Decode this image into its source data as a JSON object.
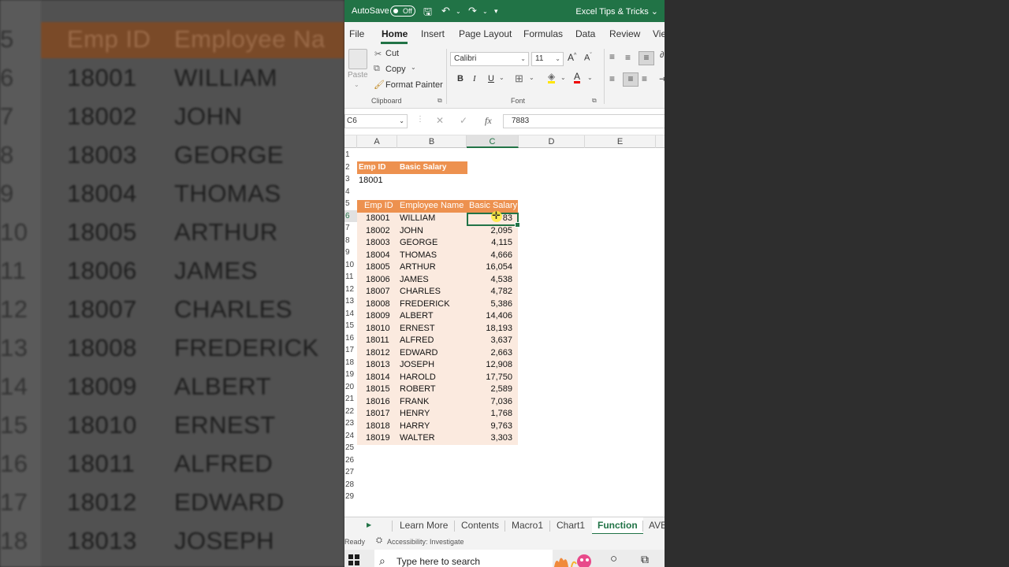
{
  "background": {
    "header": {
      "emp_id": "Emp ID",
      "employee_name": "Employee Na"
    },
    "rows": [
      {
        "num": "5",
        "id": "",
        "name": ""
      },
      {
        "num": "6",
        "id": "18001",
        "name": "WILLIAM"
      },
      {
        "num": "7",
        "id": "18002",
        "name": "JOHN"
      },
      {
        "num": "8",
        "id": "18003",
        "name": "GEORGE"
      },
      {
        "num": "9",
        "id": "18004",
        "name": "THOMAS"
      },
      {
        "num": "10",
        "id": "18005",
        "name": "ARTHUR"
      },
      {
        "num": "11",
        "id": "18006",
        "name": "JAMES"
      },
      {
        "num": "12",
        "id": "18007",
        "name": "CHARLES"
      },
      {
        "num": "13",
        "id": "18008",
        "name": "FREDERICK"
      },
      {
        "num": "14",
        "id": "18009",
        "name": "ALBERT"
      },
      {
        "num": "15",
        "id": "18010",
        "name": "ERNEST"
      },
      {
        "num": "16",
        "id": "18011",
        "name": "ALFRED"
      },
      {
        "num": "17",
        "id": "18012",
        "name": "EDWARD"
      },
      {
        "num": "18",
        "id": "18013",
        "name": "JOSEPH"
      }
    ]
  },
  "titlebar": {
    "autosave_label": "AutoSave",
    "autosave_state": "Off",
    "document_title": "Excel Tips & Tricks",
    "title_chevron": "⌄"
  },
  "tabs": [
    "File",
    "Home",
    "Insert",
    "Page Layout",
    "Formulas",
    "Data",
    "Review",
    "Vie"
  ],
  "ribbon": {
    "paste": "Paste",
    "cut": "Cut",
    "copy": "Copy",
    "format_painter": "Format Painter",
    "clipboard_group": "Clipboard",
    "font_name": "Calibri",
    "font_size": "11",
    "font_group": "Font",
    "bold": "B",
    "italic": "I",
    "underline": "U"
  },
  "formula_bar": {
    "name_box": "C6",
    "fx": "fx",
    "value": "7883"
  },
  "columns": [
    "A",
    "B",
    "C",
    "D",
    "E"
  ],
  "grid": {
    "row_numbers": [
      "1",
      "2",
      "3",
      "4",
      "5",
      "6",
      "7",
      "8",
      "9",
      "10",
      "11",
      "12",
      "13",
      "14",
      "15",
      "16",
      "17",
      "18",
      "19",
      "20",
      "21",
      "22",
      "23",
      "24",
      "25",
      "26",
      "27",
      "28",
      "29"
    ],
    "lookup_header": {
      "emp_id": "Emp ID",
      "basic_salary": "Basic Salary"
    },
    "lookup_value": "18001",
    "table_header": {
      "emp_id": "Emp ID",
      "employee_name": "Employee Name",
      "basic_salary": "Basic Salary"
    },
    "rows": [
      {
        "id": "18001",
        "name": "WILLIAM",
        "salary": "7,883"
      },
      {
        "id": "18002",
        "name": "JOHN",
        "salary": "2,095"
      },
      {
        "id": "18003",
        "name": "GEORGE",
        "salary": "4,115"
      },
      {
        "id": "18004",
        "name": "THOMAS",
        "salary": "4,666"
      },
      {
        "id": "18005",
        "name": "ARTHUR",
        "salary": "16,054"
      },
      {
        "id": "18006",
        "name": "JAMES",
        "salary": "4,538"
      },
      {
        "id": "18007",
        "name": "CHARLES",
        "salary": "4,782"
      },
      {
        "id": "18008",
        "name": "FREDERICK",
        "salary": "5,386"
      },
      {
        "id": "18009",
        "name": "ALBERT",
        "salary": "14,406"
      },
      {
        "id": "18010",
        "name": "ERNEST",
        "salary": "18,193"
      },
      {
        "id": "18011",
        "name": "ALFRED",
        "salary": "3,637"
      },
      {
        "id": "18012",
        "name": "EDWARD",
        "salary": "2,663"
      },
      {
        "id": "18013",
        "name": "JOSEPH",
        "salary": "12,908"
      },
      {
        "id": "18014",
        "name": "HAROLD",
        "salary": "17,750"
      },
      {
        "id": "18015",
        "name": "ROBERT",
        "salary": "2,589"
      },
      {
        "id": "18016",
        "name": "FRANK",
        "salary": "7,036"
      },
      {
        "id": "18017",
        "name": "HENRY",
        "salary": "1,768"
      },
      {
        "id": "18018",
        "name": "HARRY",
        "salary": "9,763"
      },
      {
        "id": "18019",
        "name": "WALTER",
        "salary": "3,303"
      }
    ],
    "selected_cell_visible_text": "83"
  },
  "sheet_tabs": [
    "Learn More",
    "Contents",
    "Macro1",
    "Chart1",
    "Function",
    "AVE"
  ],
  "active_sheet": "Function",
  "status": {
    "ready": "Ready",
    "accessibility": "Accessibility: Investigate"
  },
  "taskbar": {
    "search_placeholder": "Type here to search"
  },
  "colors": {
    "excel_green": "#217346",
    "header_orange": "#ed914f"
  }
}
